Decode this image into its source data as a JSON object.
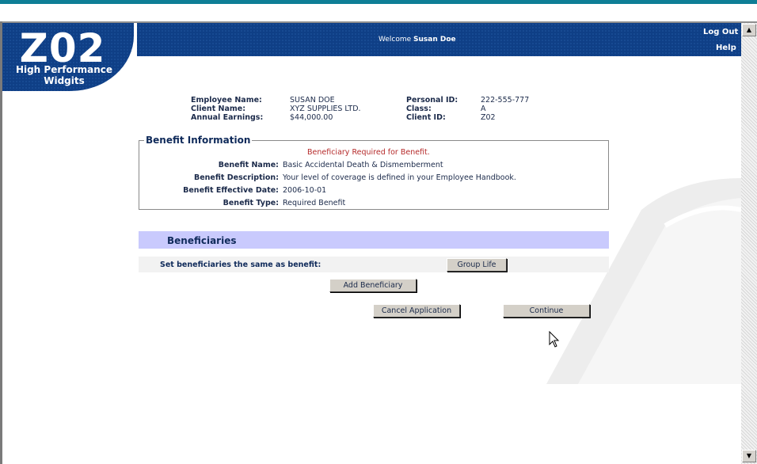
{
  "header": {
    "logo_main": "Z02",
    "logo_line1": "High Performance",
    "logo_line2": "Widgits",
    "welcome_prefix": "Welcome",
    "welcome_name": "Susan Doe",
    "logout": "Log Out",
    "help": "Help"
  },
  "employee": {
    "name_label": "Employee Name:",
    "name": "SUSAN DOE",
    "client_label": "Client Name:",
    "client": "XYZ SUPPLIES LTD.",
    "earnings_label": "Annual Earnings:",
    "earnings": "$44,000.00",
    "pid_label": "Personal ID:",
    "pid": "222-555-777",
    "class_label": "Class:",
    "class": "A",
    "cid_label": "Client ID:",
    "cid": "Z02"
  },
  "benefit": {
    "legend": "Benefit Information",
    "required_msg": "Beneficiary Required for Benefit.",
    "name_label": "Benefit Name:",
    "name": "Basic Accidental Death & Dismemberment",
    "desc_label": "Benefit Description:",
    "desc": "Your level of coverage is defined in your Employee Handbook.",
    "date_label": "Benefit Effective Date:",
    "date": "2006-10-01",
    "type_label": "Benefit Type:",
    "type": "Required Benefit"
  },
  "beneficiaries": {
    "title": "Beneficiaries",
    "same_label": "Set beneficiaries the same as benefit:",
    "group_life": "Group Life",
    "add": "Add Beneficiary",
    "cancel": "Cancel Application",
    "continue": "Continue"
  }
}
